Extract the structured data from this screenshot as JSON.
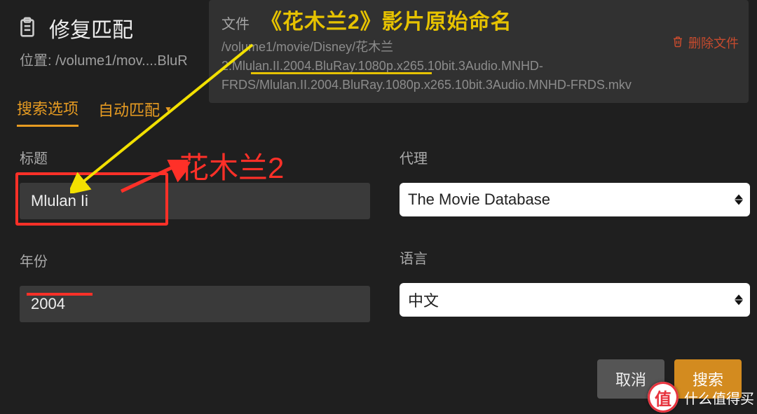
{
  "header": {
    "title": "修复匹配",
    "location_label": "位置:",
    "location_value": "/volume1/mov....BluR"
  },
  "file_box": {
    "label": "文件",
    "annotation": "《花木兰2》影片原始命名",
    "path": "/volume1/movie/Disney/花木兰2.Mlulan.II.2004.BluRay.1080p.x265.10bit.3Audio.MNHD-FRDS/Mlulan.II.2004.BluRay.1080p.x265.10bit.3Audio.MNHD-FRDS.mkv",
    "delete_label": "删除文件"
  },
  "tabs": {
    "search_options": "搜索选项",
    "auto_match": "自动匹配"
  },
  "form": {
    "title_label": "标题",
    "title_value": "Mlulan Ii",
    "year_label": "年份",
    "year_value": "2004",
    "agent_label": "代理",
    "agent_value": "The Movie Database",
    "language_label": "语言",
    "language_value": "中文"
  },
  "annotations": {
    "big_red": "花木兰2"
  },
  "footer": {
    "cancel": "取消",
    "search": "搜索"
  },
  "watermark": {
    "circle": "值",
    "text": "什么值得买"
  }
}
